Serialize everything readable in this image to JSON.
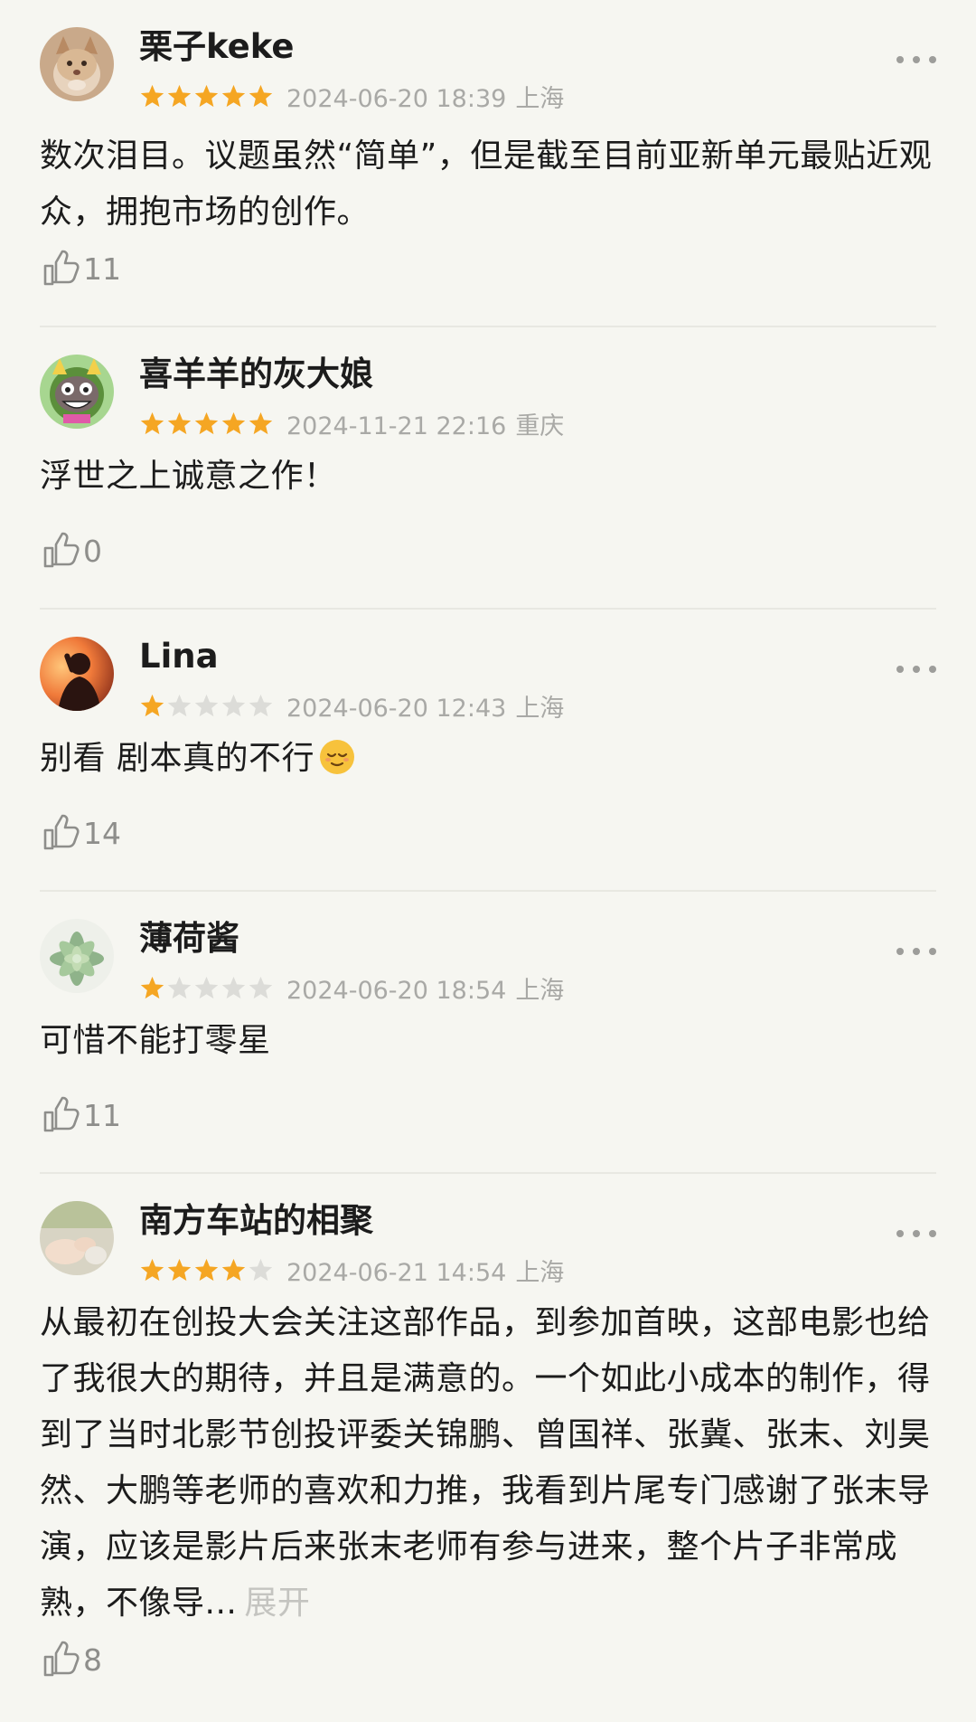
{
  "reviews": [
    {
      "username": "栗子keke",
      "rating": 5,
      "datetime": "2024-06-20 18:39",
      "location": "上海",
      "text": "数次泪目。议题虽然“简单”，但是截至目前亚新单元最贴近观众，拥抱市场的创作。",
      "likes": "11",
      "avatar": "cat-photo-avatar",
      "has_more_menu": true
    },
    {
      "username": "喜羊羊的灰大娘",
      "rating": 5,
      "datetime": "2024-11-21 22:16",
      "location": "重庆",
      "text": "浮世之上诚意之作！",
      "likes": "0",
      "avatar": "cartoon-wolf-avatar",
      "has_more_menu": false
    },
    {
      "username": "Lina",
      "rating": 1,
      "datetime": "2024-06-20 12:43",
      "location": "上海",
      "text": "别看 剧本真的不行",
      "emoji": "relieved-face-emoji",
      "likes": "14",
      "avatar": "silhouette-sunset-avatar",
      "has_more_menu": true
    },
    {
      "username": "薄荷酱",
      "rating": 1,
      "datetime": "2024-06-20 18:54",
      "location": "上海",
      "text": "可惜不能打零星",
      "likes": "11",
      "avatar": "succulent-plant-avatar",
      "has_more_menu": true
    },
    {
      "username": "南方车站的相聚",
      "rating": 4,
      "datetime": "2024-06-21 14:54",
      "location": "上海",
      "text": "从最初在创投大会关注这部作品，到参加首映，这部电影也给了我很大的期待，并且是满意的。一个如此小成本的制作，得到了当时北影节创投评委关锦鹏、曾国祥、张冀、张末、刘昊然、大鹏等老师的喜欢和力推，我看到片尾专门感谢了张末导演，应该是影片后来张末老师有参与进来，整个片子非常成熟，不像导...",
      "expand_label": "展开",
      "likes": "8",
      "avatar": "hand-photo-avatar",
      "has_more_menu": true
    }
  ],
  "colors": {
    "background": "#f6f6f1",
    "star_filled": "#f5a623",
    "star_empty": "#dcdcd8",
    "meta_text": "#a9a9a6",
    "divider": "#e8e8e2"
  }
}
